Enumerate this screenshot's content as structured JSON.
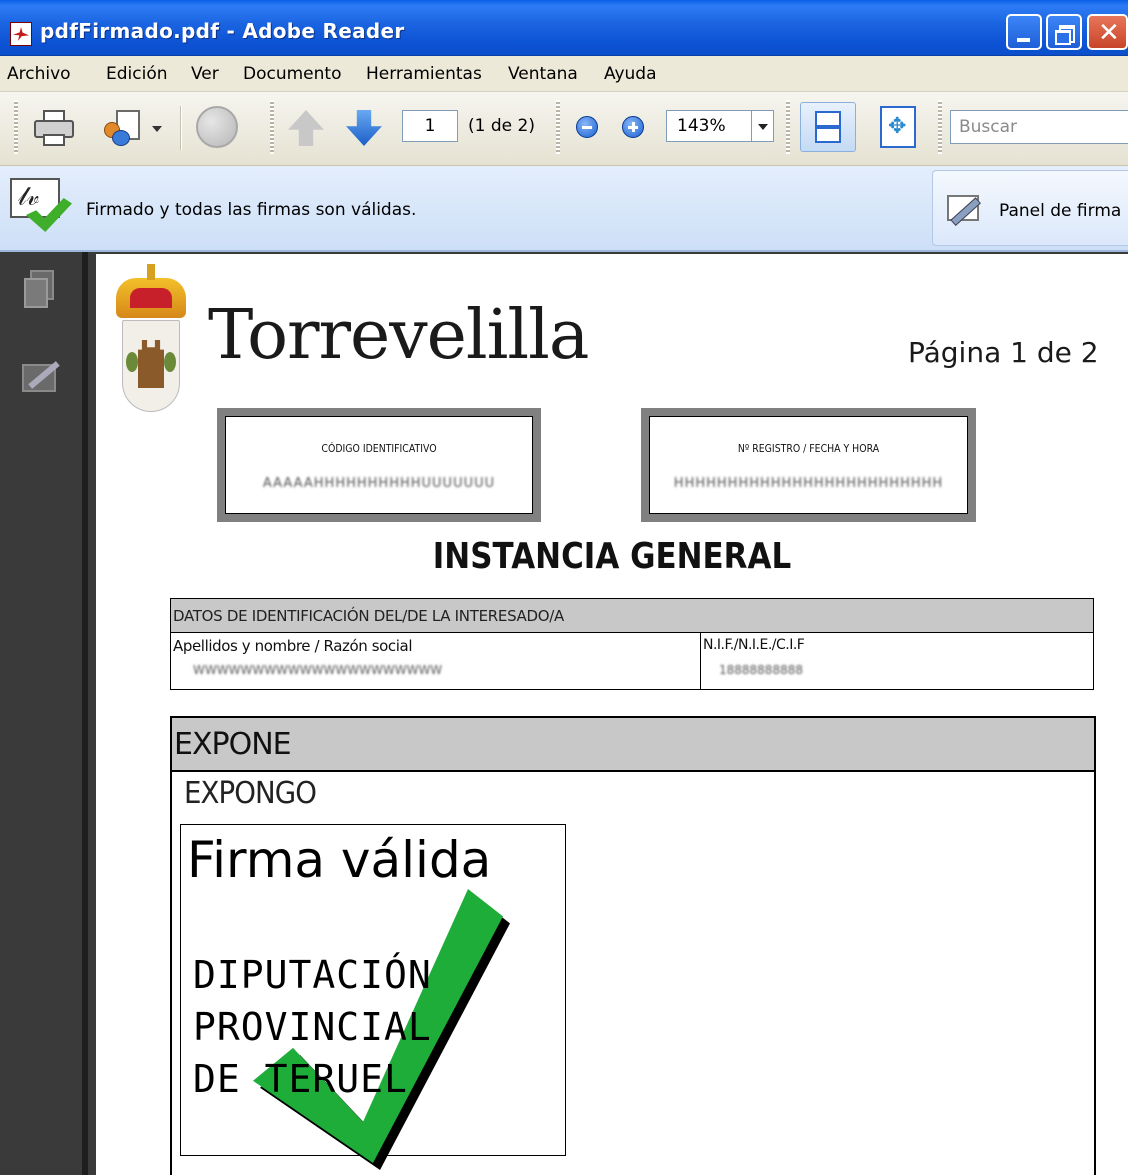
{
  "window": {
    "title": "pdfFirmado.pdf - Adobe Reader"
  },
  "menu": [
    "Archivo",
    "Edición",
    "Ver",
    "Documento",
    "Herramientas",
    "Ventana",
    "Ayuda"
  ],
  "toolbar": {
    "page_number": "1",
    "page_count": "(1 de 2)",
    "zoom": "143%",
    "search_placeholder": "Buscar"
  },
  "signature_bar": {
    "status": "Firmado y todas las firmas son válidas.",
    "panel_button": "Panel de firma"
  },
  "document": {
    "title": "Torrevelilla",
    "page_label": "Página 1 de 2",
    "id_code_label": "CÓDIGO IDENTIFICATIVO",
    "id_code_value": "AAAAAHHHHHHHHHHUUUUUUU",
    "registro_label": "Nº REGISTRO / FECHA Y HORA",
    "registro_value": "HHHHHHHHHHHHHHHHHHHHHHHHH",
    "heading": "INSTANCIA GENERAL",
    "datos_header": "DATOS DE IDENTIFICACIÓN DEL/DE LA INTERESADO/A",
    "apellidos_label": "Apellidos y nombre / Razón social",
    "apellidos_value": "WWWWWWWWWWWWWWWWWWWWW",
    "nif_label": "N.I.F./N.I.E./C.I.F",
    "nif_value": "18888888888",
    "expone_header": "EXPONE",
    "expone_body": "EXPONGO",
    "signature": {
      "status": "Firma válida",
      "entity": "DIPUTACIÓN\nPROVINCIAL\nDE TERUEL"
    }
  }
}
